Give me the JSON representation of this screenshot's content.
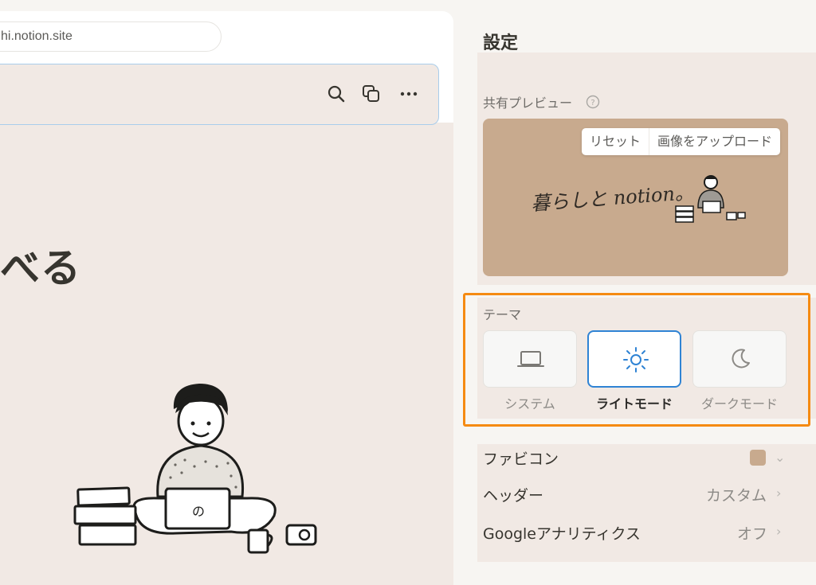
{
  "browser": {
    "url": "hi.notion.site"
  },
  "page": {
    "title_fragment": "べる"
  },
  "settings": {
    "title": "設定",
    "share_preview": {
      "label": "共有プレビュー",
      "help_icon": "question-circle-icon",
      "reset_label": "リセット",
      "upload_label": "画像をアップロード",
      "preview_image_text": "暮らしと notion。"
    },
    "theme": {
      "label": "テーマ",
      "options": [
        {
          "label": "システム",
          "icon": "laptop-icon",
          "selected": false
        },
        {
          "label": "ライトモード",
          "icon": "sun-icon",
          "selected": true
        },
        {
          "label": "ダークモード",
          "icon": "moon-icon",
          "selected": false
        }
      ]
    },
    "rows": [
      {
        "label": "ファビコン",
        "value": ""
      },
      {
        "label": "ヘッダー",
        "value": "カスタム"
      },
      {
        "label": "Googleアナリティクス",
        "value": "オフ"
      }
    ]
  },
  "colors": {
    "highlight": "#f58a12",
    "selected_border": "#2f83d4",
    "page_background": "#f1e9e4",
    "card_background": "#c8aa8e"
  }
}
